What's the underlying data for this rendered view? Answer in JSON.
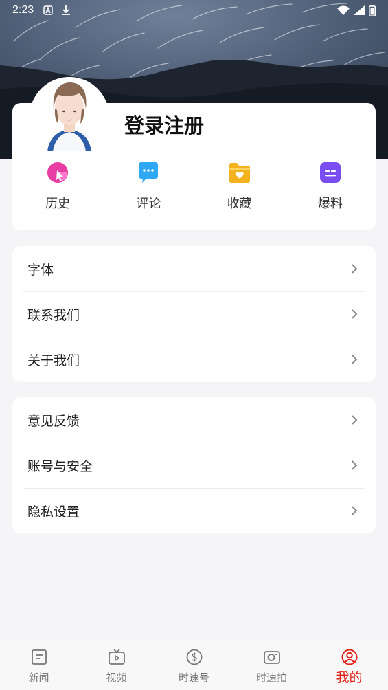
{
  "status_bar": {
    "time": "2:23",
    "left_icons": [
      "app-a-icon",
      "download-icon"
    ],
    "right_icons": [
      "wifi-icon",
      "signal-icon",
      "battery-icon"
    ]
  },
  "profile": {
    "login_label": "登录注册"
  },
  "quick_actions": [
    {
      "label": "历史",
      "icon": "history-icon",
      "color": "#e83ea3"
    },
    {
      "label": "评论",
      "icon": "comment-icon",
      "color": "#2ea7f5"
    },
    {
      "label": "收藏",
      "icon": "favorite-icon",
      "color": "#f5b21f"
    },
    {
      "label": "爆料",
      "icon": "tip-off-icon",
      "color": "#7a4df0"
    }
  ],
  "menu_group_1": [
    {
      "label": "字体"
    },
    {
      "label": "联系我们"
    },
    {
      "label": "关于我们"
    }
  ],
  "menu_group_2": [
    {
      "label": "意见反馈"
    },
    {
      "label": "账号与安全"
    },
    {
      "label": "隐私设置"
    }
  ],
  "tab_bar": {
    "active": "我的",
    "active_color": "#e2231a",
    "tabs": [
      {
        "label": "新闻",
        "icon": "news-icon"
      },
      {
        "label": "视频",
        "icon": "video-icon"
      },
      {
        "label": "时速号",
        "icon": "shisu-hao-icon"
      },
      {
        "label": "时速拍",
        "icon": "camera-icon"
      },
      {
        "label": "我的",
        "icon": "profile-icon"
      }
    ]
  }
}
